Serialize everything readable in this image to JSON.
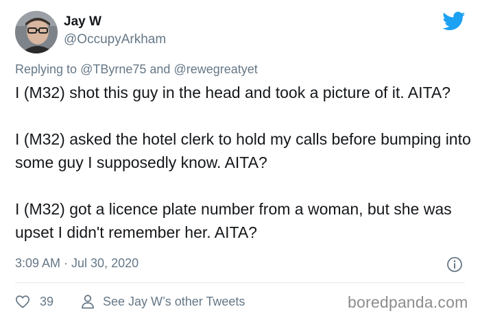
{
  "author": {
    "display_name": "Jay W",
    "handle": "@OccupyArkham"
  },
  "reply": {
    "prefix": "Replying to",
    "mention_1": "@TByrne75",
    "conjunction": "and",
    "mention_2": "@rewegreatyet"
  },
  "tweet": {
    "paragraphs": [
      "I (M32) shot this guy in the head and took a picture of it. AITA?",
      "I (M32) asked the hotel clerk to hold my calls before bumping into some guy I supposedly know. AITA?",
      "I (M32) got a licence plate number from a woman, but she was upset I didn't remember her. AITA?"
    ],
    "timestamp": "3:09 AM · Jul 30, 2020"
  },
  "actions": {
    "like_count": "39",
    "other_tweets_label": "See Jay W’s other Tweets"
  },
  "watermark": "boredpanda.com",
  "colors": {
    "twitter_blue": "#1da1f2",
    "secondary_text": "#657786",
    "primary_text": "#14171a",
    "divider": "#e1e8ed"
  },
  "icons": {
    "logo": "twitter-bird-icon",
    "info": "info-icon",
    "like": "heart-icon",
    "profile": "person-icon"
  }
}
